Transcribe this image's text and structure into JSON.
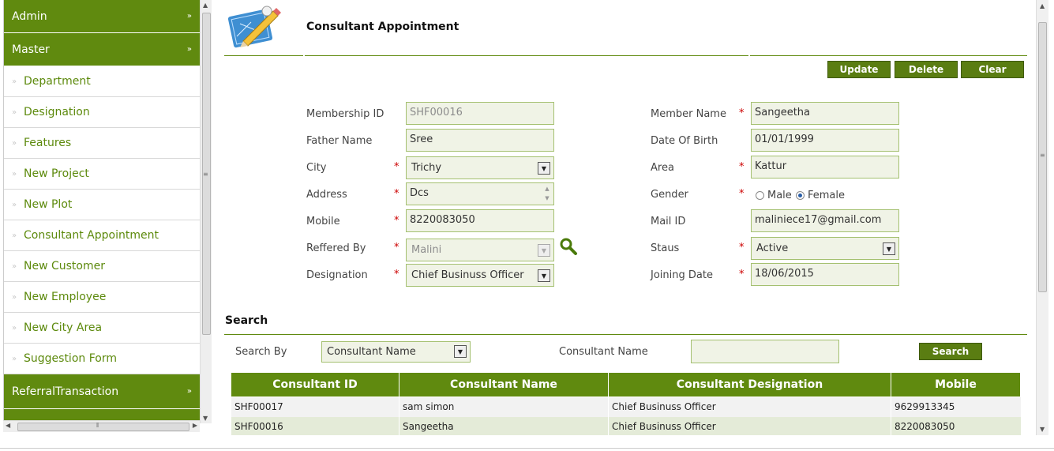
{
  "sidebar": {
    "sections": {
      "admin": "Admin",
      "master": "Master",
      "referral": "ReferralTransaction"
    },
    "items": [
      {
        "label": "Department"
      },
      {
        "label": "Designation"
      },
      {
        "label": "Features"
      },
      {
        "label": "New Project"
      },
      {
        "label": "New Plot"
      },
      {
        "label": "Consultant Appointment"
      },
      {
        "label": "New Customer"
      },
      {
        "label": "New Employee"
      },
      {
        "label": "New City Area"
      },
      {
        "label": "Suggestion Form"
      }
    ]
  },
  "header": {
    "title": "Consultant Appointment"
  },
  "toolbar": {
    "update": "Update",
    "delete": "Delete",
    "clear": "Clear"
  },
  "form": {
    "membership_id": {
      "label": "Membership ID",
      "value": "SHF00016"
    },
    "father_name": {
      "label": "Father Name",
      "value": "Sree"
    },
    "city": {
      "label": "City",
      "value": "Trichy"
    },
    "address": {
      "label": "Address",
      "value": "Dcs"
    },
    "mobile": {
      "label": "Mobile",
      "value": "8220083050"
    },
    "referred_by": {
      "label": "Reffered By",
      "value": "Malini"
    },
    "designation": {
      "label": "Designation",
      "value": "Chief Businuss Officer"
    },
    "member_name": {
      "label": "Member Name",
      "value": "Sangeetha"
    },
    "dob": {
      "label": "Date Of Birth",
      "value": "01/01/1999"
    },
    "area": {
      "label": "Area",
      "value": "Kattur"
    },
    "gender": {
      "label": "Gender",
      "options": [
        "Male",
        "Female"
      ],
      "selected": "Female"
    },
    "mail": {
      "label": "Mail ID",
      "value": "maliniece17@gmail.com"
    },
    "status": {
      "label": "Staus",
      "value": "Active"
    },
    "joining_date": {
      "label": "Joining Date",
      "value": "18/06/2015"
    },
    "required_mark": "*"
  },
  "search": {
    "title": "Search",
    "by_label": "Search By",
    "by_value": "Consultant Name",
    "name_label": "Consultant Name",
    "name_value": "",
    "button": "Search"
  },
  "table": {
    "headers": [
      "Consultant ID",
      "Consultant Name",
      "Consultant Designation",
      "Mobile"
    ],
    "rows": [
      [
        "SHF00017",
        "sam simon",
        "Chief Businuss Officer",
        "9629913345"
      ],
      [
        "SHF00016",
        "Sangeetha",
        "Chief Businuss Officer",
        "8220083050"
      ]
    ]
  },
  "colors": {
    "accent": "#608a0f",
    "link": "#5d8a0d",
    "field_bg": "#f0f3e6",
    "required": "#cc0000"
  }
}
